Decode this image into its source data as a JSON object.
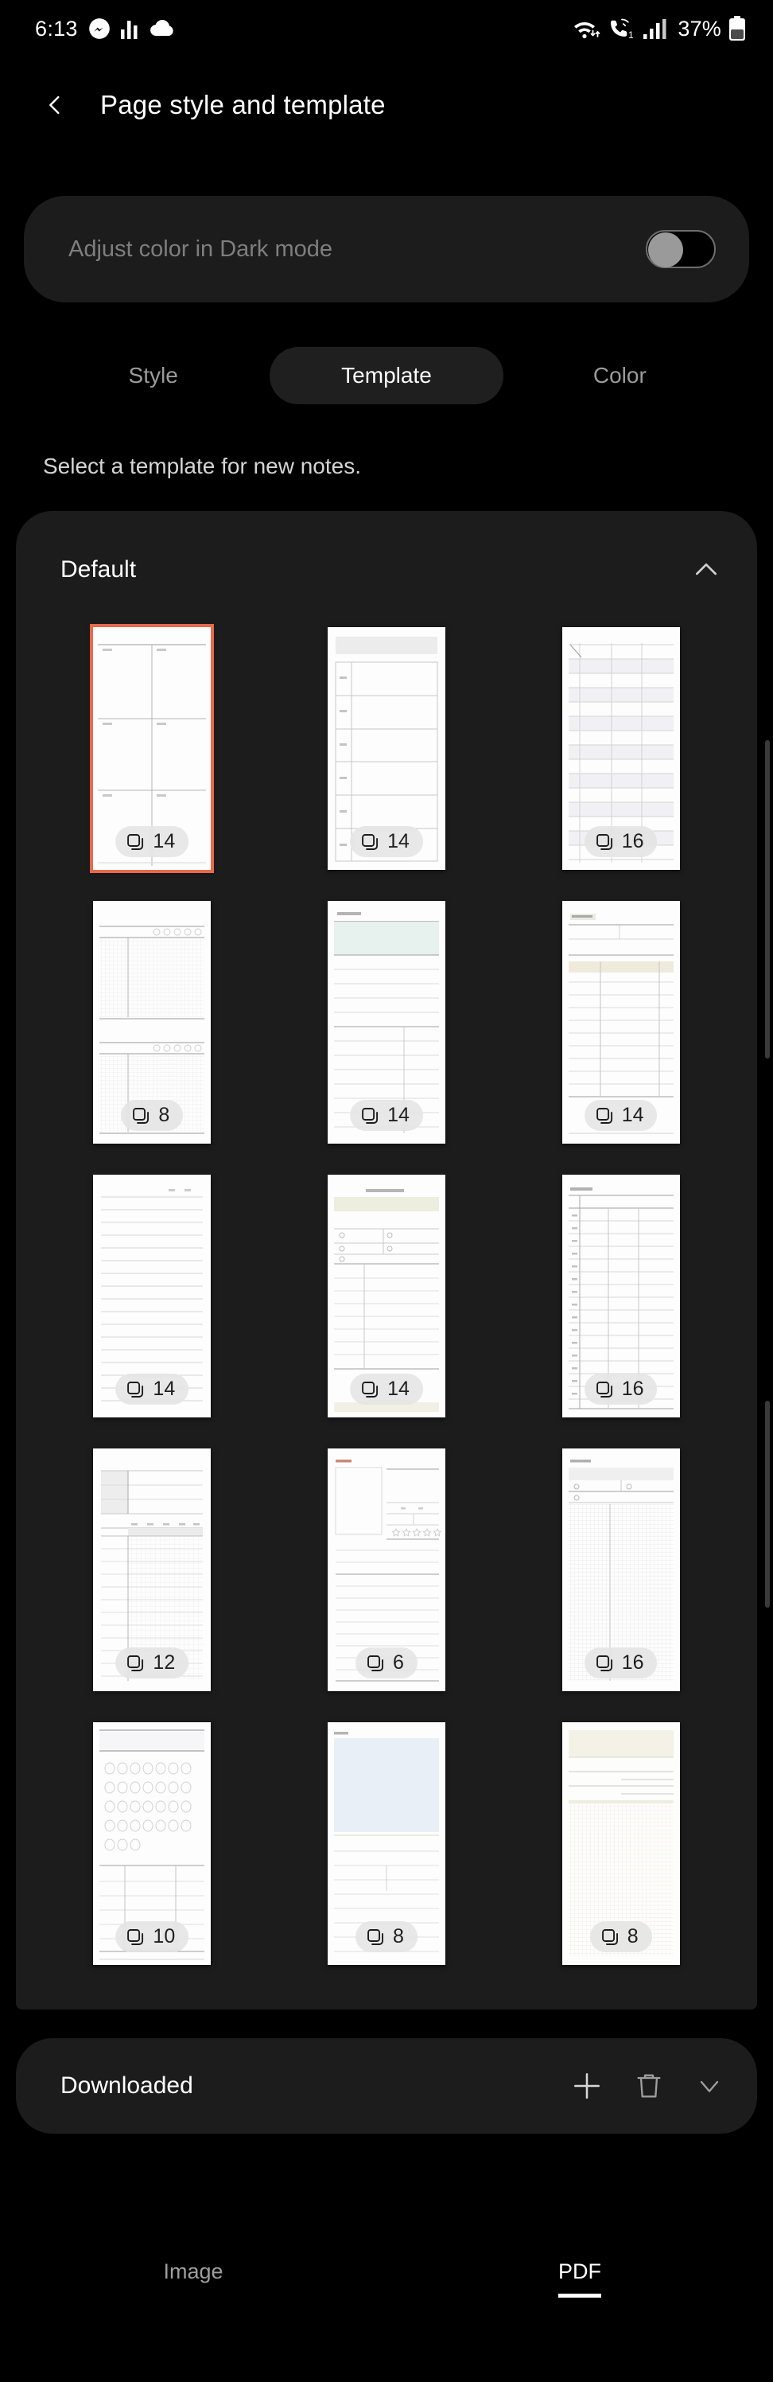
{
  "status_bar": {
    "time": "6:13",
    "left_icons": [
      "messenger-icon",
      "bar-chart-icon",
      "cloud-icon"
    ],
    "right_icons": [
      "wifi-icon",
      "wifi-calling-icon",
      "signal-bars-icon",
      "battery-icon"
    ],
    "battery_percent": "37%",
    "sim_badge": "1"
  },
  "header": {
    "back_icon": "chevron-left-icon",
    "title": "Page style and template"
  },
  "dark_mode": {
    "label": "Adjust color in Dark mode",
    "toggle_state": "off"
  },
  "tabs": [
    {
      "label": "Style",
      "selected": false
    },
    {
      "label": "Template",
      "selected": true
    },
    {
      "label": "Color",
      "selected": false
    }
  ],
  "section_hint": "Select a template for new notes.",
  "default_section": {
    "title": "Default",
    "collapse_icon": "chevron-up-icon",
    "expanded": true,
    "templates": [
      {
        "name": "monthly-calendar-grid",
        "count": "14",
        "selected": true,
        "badge_icon": "copy-pages-icon"
      },
      {
        "name": "monthly-list",
        "count": "14",
        "selected": false,
        "badge_icon": "copy-pages-icon"
      },
      {
        "name": "ruled-table",
        "count": "16",
        "selected": false,
        "badge_icon": "copy-pages-icon"
      },
      {
        "name": "graph-mood-tracker",
        "count": "8",
        "selected": false,
        "badge_icon": "copy-pages-icon"
      },
      {
        "name": "workout-plan",
        "count": "14",
        "selected": false,
        "badge_icon": "copy-pages-icon"
      },
      {
        "name": "daily-plan",
        "count": "14",
        "selected": false,
        "badge_icon": "copy-pages-icon"
      },
      {
        "name": "lined-notes",
        "count": "14",
        "selected": false,
        "badge_icon": "copy-pages-icon"
      },
      {
        "name": "class-information",
        "count": "14",
        "selected": false,
        "badge_icon": "copy-pages-icon"
      },
      {
        "name": "quarterly-numbered",
        "count": "16",
        "selected": false,
        "badge_icon": "copy-pages-icon"
      },
      {
        "name": "habit-tracker",
        "count": "12",
        "selected": false,
        "badge_icon": "copy-pages-icon"
      },
      {
        "name": "review-rating",
        "count": "6",
        "selected": false,
        "badge_icon": "copy-pages-icon"
      },
      {
        "name": "travel-plan-grid",
        "count": "16",
        "selected": false,
        "badge_icon": "copy-pages-icon"
      },
      {
        "name": "circle-tracker",
        "count": "10",
        "selected": false,
        "badge_icon": "copy-pages-icon"
      },
      {
        "name": "profile-photo",
        "count": "8",
        "selected": false,
        "badge_icon": "copy-pages-icon"
      },
      {
        "name": "cream-grid",
        "count": "8",
        "selected": false,
        "badge_icon": "copy-pages-icon"
      }
    ]
  },
  "downloaded_section": {
    "title": "Downloaded",
    "actions": [
      "plus-icon",
      "trash-icon",
      "chevron-down-icon"
    ]
  },
  "bottom_bar": [
    {
      "label": "Image",
      "selected": false
    },
    {
      "label": "PDF",
      "selected": true
    }
  ],
  "colors": {
    "background": "#000000",
    "card": "#1c1c1c",
    "selected_template_border": "#e8694c",
    "text_primary": "#ffffff",
    "text_secondary": "#9b9b9b"
  }
}
